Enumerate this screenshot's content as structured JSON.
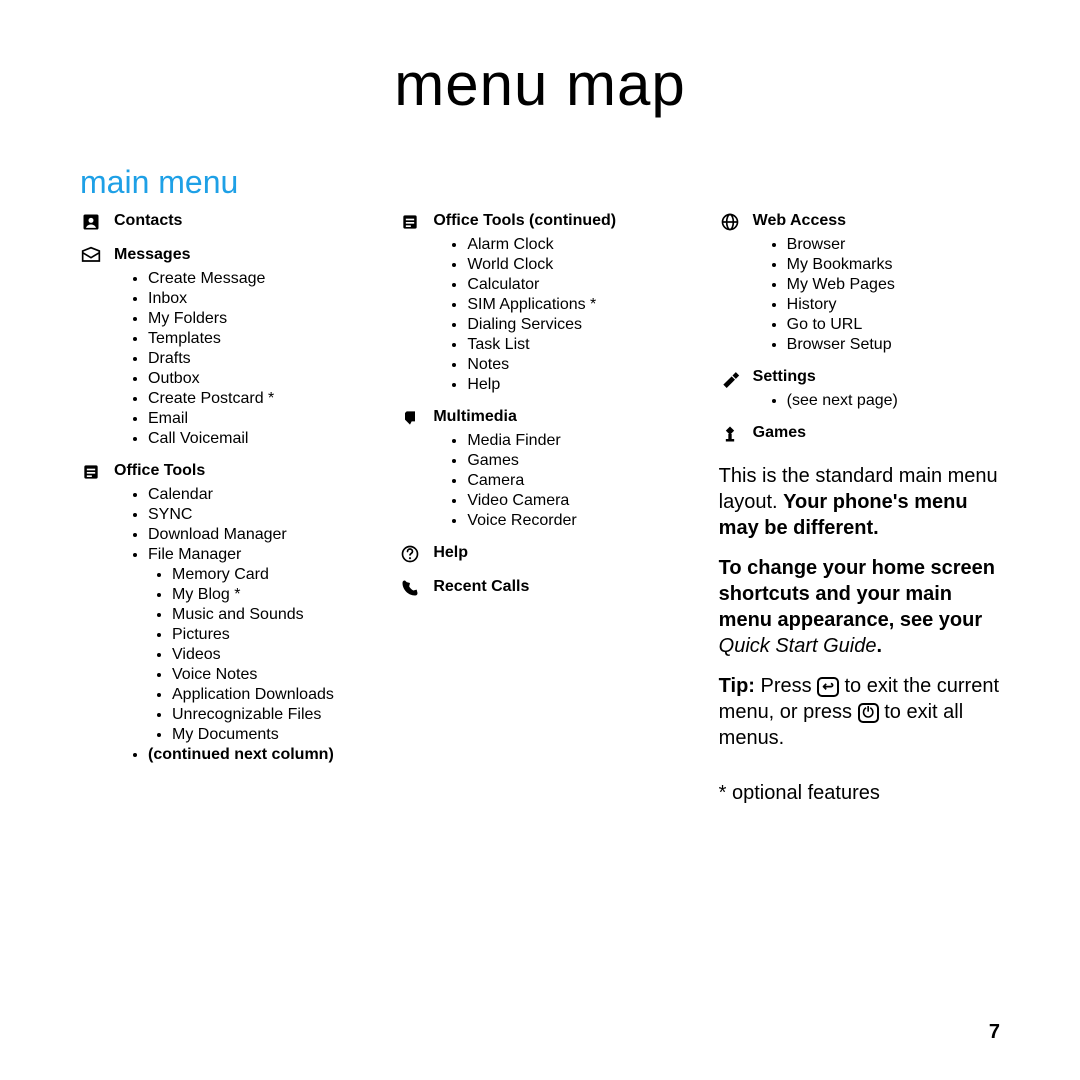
{
  "title": "menu map",
  "section_title": "main menu",
  "page_number": "7",
  "col1": {
    "contacts_label": "Contacts",
    "messages_label": "Messages",
    "messages_items": [
      "Create Message",
      "Inbox",
      "My Folders",
      "Templates",
      "Drafts",
      "Outbox",
      "Create Postcard *",
      "Email",
      "Call Voicemail"
    ],
    "office_tools_label": "Office Tools",
    "office_tools_items": [
      "Calendar",
      "SYNC",
      "Download Manager"
    ],
    "file_manager_label": "File Manager",
    "file_manager_items": [
      "Memory Card",
      "My Blog *",
      "Music and Sounds",
      "Pictures",
      "Videos",
      "Voice Notes",
      "Application Downloads",
      "Unrecognizable Files",
      "My Documents"
    ],
    "continued_label": "(continued next column)"
  },
  "col2": {
    "office_tools_cont_label": "Office Tools (continued)",
    "office_tools_cont_items": [
      "Alarm Clock",
      "World Clock",
      "Calculator",
      "SIM Applications *",
      "Dialing Services",
      "Task List",
      "Notes",
      "Help"
    ],
    "multimedia_label": "Multimedia",
    "multimedia_items": [
      "Media Finder",
      "Games",
      "Camera",
      "Video Camera",
      "Voice Recorder"
    ],
    "help_label": "Help",
    "recent_calls_label": "Recent Calls"
  },
  "col3": {
    "web_access_label": "Web Access",
    "web_access_items": [
      "Browser",
      "My Bookmarks",
      "My Web Pages",
      "History",
      "Go to URL",
      "Browser Setup"
    ],
    "settings_label": "Settings",
    "settings_items": [
      "(see next page)"
    ],
    "games_label": "Games",
    "note1_a": "This is the standard main menu layout. ",
    "note1_b": "Your phone's menu may be different.",
    "note2_a": "To change your home screen shortcuts and your main menu appearance, see your ",
    "note2_b": "Quick Start Guide",
    "note2_c": ".",
    "tip_label": "Tip:",
    "tip_a": " Press ",
    "tip_key1": "↩",
    "tip_b": " to exit the current menu, or press ",
    "tip_key2": "⏻",
    "tip_c": " to exit all menus.",
    "optional_label": "* optional features"
  }
}
